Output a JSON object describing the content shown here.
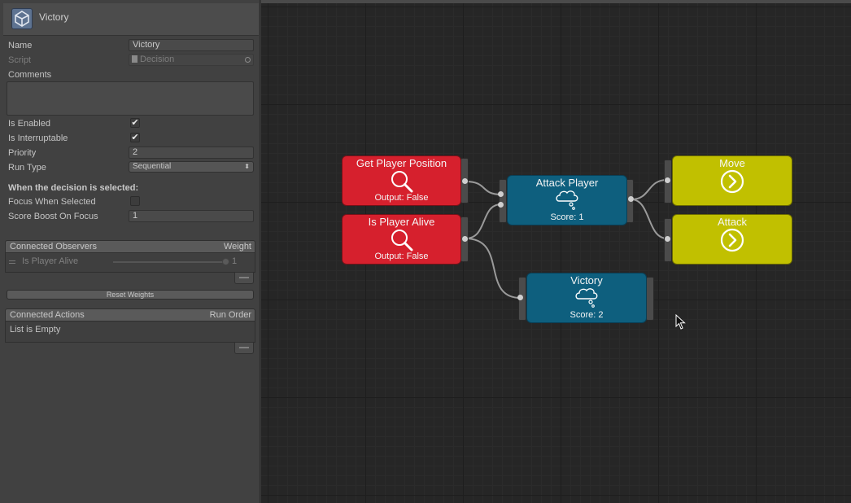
{
  "inspector": {
    "title": "Victory",
    "fields": {
      "name_label": "Name",
      "name_value": "Victory",
      "script_label": "Script",
      "script_value": "Decision",
      "comments_label": "Comments",
      "is_enabled_label": "Is Enabled",
      "is_enabled": true,
      "is_interruptable_label": "Is Interruptable",
      "is_interruptable": true,
      "priority_label": "Priority",
      "priority_value": "2",
      "run_type_label": "Run Type",
      "run_type_value": "Sequential"
    },
    "selected_section": {
      "heading": "When the decision is selected:",
      "focus_label": "Focus When Selected",
      "focus_checked": false,
      "score_boost_label": "Score Boost On Focus",
      "score_boost_value": "1"
    },
    "observers": {
      "title": "Connected Observers",
      "column": "Weight",
      "items": [
        {
          "name": "Is Player Alive",
          "weight": "1"
        }
      ],
      "reset_label": "Reset Weights"
    },
    "actions": {
      "title": "Connected Actions",
      "column": "Run Order",
      "empty_text": "List is Empty"
    },
    "minus_glyph": "—",
    "check_glyph": "✔",
    "dropdown_arrow": "⬍"
  },
  "graph": {
    "nodes": {
      "get_player_position": {
        "title": "Get Player Position",
        "subtitle": "Output: False",
        "icon": "magnifier-icon"
      },
      "is_player_alive": {
        "title": "Is Player Alive",
        "subtitle": "Output: False",
        "icon": "magnifier-icon"
      },
      "attack_player": {
        "title": "Attack Player",
        "subtitle": "Score: 1",
        "icon": "thought-bubble-icon"
      },
      "victory": {
        "title": "Victory",
        "subtitle": "Score: 2",
        "icon": "thought-bubble-icon"
      },
      "move": {
        "title": "Move",
        "icon": "arrow-circle-icon"
      },
      "attack": {
        "title": "Attack",
        "icon": "arrow-circle-icon"
      }
    },
    "colors": {
      "observer": "#d6202d",
      "decision": "#0e5f7e",
      "action": "#c1c000",
      "wire": "#a0a0a0"
    }
  }
}
